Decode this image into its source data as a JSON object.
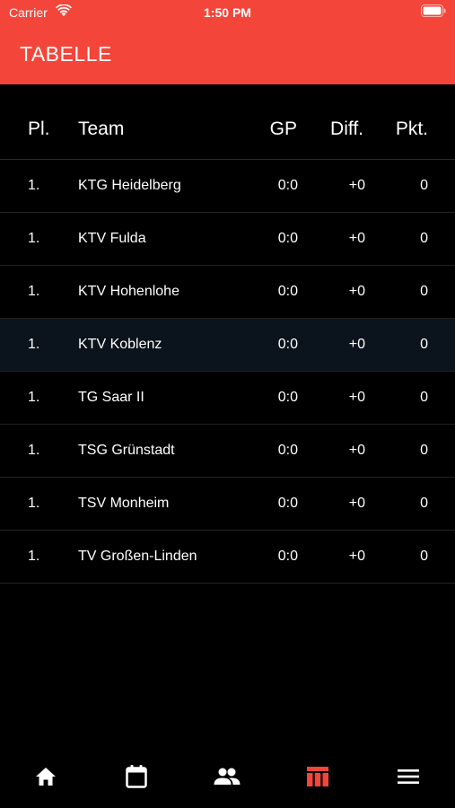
{
  "status_bar": {
    "carrier": "Carrier",
    "time": "1:50 PM"
  },
  "header": {
    "title": "TABELLE",
    "color": "#f4453a"
  },
  "table": {
    "columns": {
      "pl": "Pl.",
      "team": "Team",
      "gp": "GP",
      "diff": "Diff.",
      "pkt": "Pkt."
    },
    "rows": [
      {
        "pl": "1.",
        "team": "KTG Heidelberg",
        "gp": "0:0",
        "diff": "+0",
        "pkt": "0"
      },
      {
        "pl": "1.",
        "team": "KTV Fulda",
        "gp": "0:0",
        "diff": "+0",
        "pkt": "0"
      },
      {
        "pl": "1.",
        "team": "KTV Hohenlohe",
        "gp": "0:0",
        "diff": "+0",
        "pkt": "0"
      },
      {
        "pl": "1.",
        "team": "KTV Koblenz",
        "gp": "0:0",
        "diff": "+0",
        "pkt": "0"
      },
      {
        "pl": "1.",
        "team": "TG Saar II",
        "gp": "0:0",
        "diff": "+0",
        "pkt": "0"
      },
      {
        "pl": "1.",
        "team": "TSG Grünstadt",
        "gp": "0:0",
        "diff": "+0",
        "pkt": "0"
      },
      {
        "pl": "1.",
        "team": "TSV Monheim",
        "gp": "0:0",
        "diff": "+0",
        "pkt": "0"
      },
      {
        "pl": "1.",
        "team": "TV Großen-Linden",
        "gp": "0:0",
        "diff": "+0",
        "pkt": "0"
      }
    ]
  },
  "tabbar": {
    "items": [
      {
        "icon": "home-icon"
      },
      {
        "icon": "calendar-icon"
      },
      {
        "icon": "people-icon"
      },
      {
        "icon": "table-icon",
        "active": true
      },
      {
        "icon": "menu-icon"
      }
    ],
    "active_color": "#f4453a",
    "inactive_color": "#ffffff"
  }
}
